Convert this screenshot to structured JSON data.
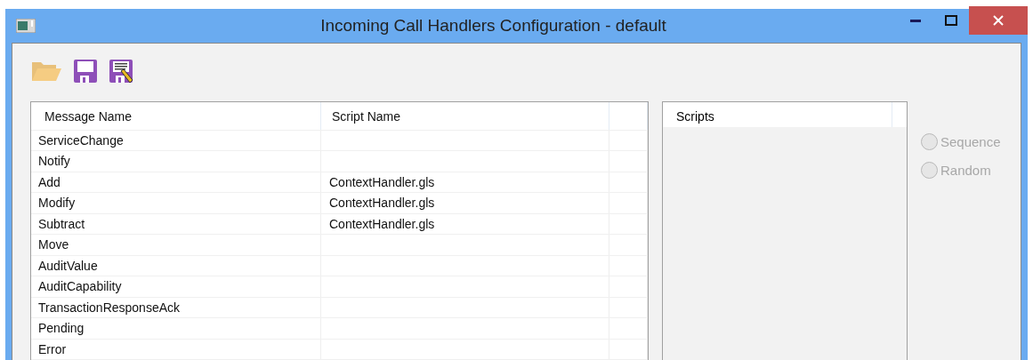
{
  "window": {
    "title": "Incoming Call Handlers Configuration - default"
  },
  "toolbar": [
    {
      "kind": "open"
    },
    {
      "kind": "save"
    },
    {
      "kind": "save_as"
    }
  ],
  "table": {
    "columns": [
      "Message Name",
      "Script Name"
    ],
    "rows": [
      {
        "message": "ServiceChange"
      },
      {
        "message": "Notify"
      },
      {
        "message": "Add",
        "script": "ContextHandler.gls"
      },
      {
        "message": "Modify",
        "script": "ContextHandler.gls"
      },
      {
        "message": "Subtract",
        "script": "ContextHandler.gls"
      },
      {
        "message": "Move"
      },
      {
        "message": "AuditValue"
      },
      {
        "message": "AuditCapability"
      },
      {
        "message": "TransactionResponseAck"
      },
      {
        "message": "Pending"
      },
      {
        "message": "Error"
      }
    ]
  },
  "scripts": {
    "columns": [
      "Scripts"
    ]
  },
  "order": [
    {
      "label": "Sequence",
      "selected": false,
      "disabled": true
    },
    {
      "label": "Random",
      "selected": false,
      "disabled": true
    }
  ]
}
